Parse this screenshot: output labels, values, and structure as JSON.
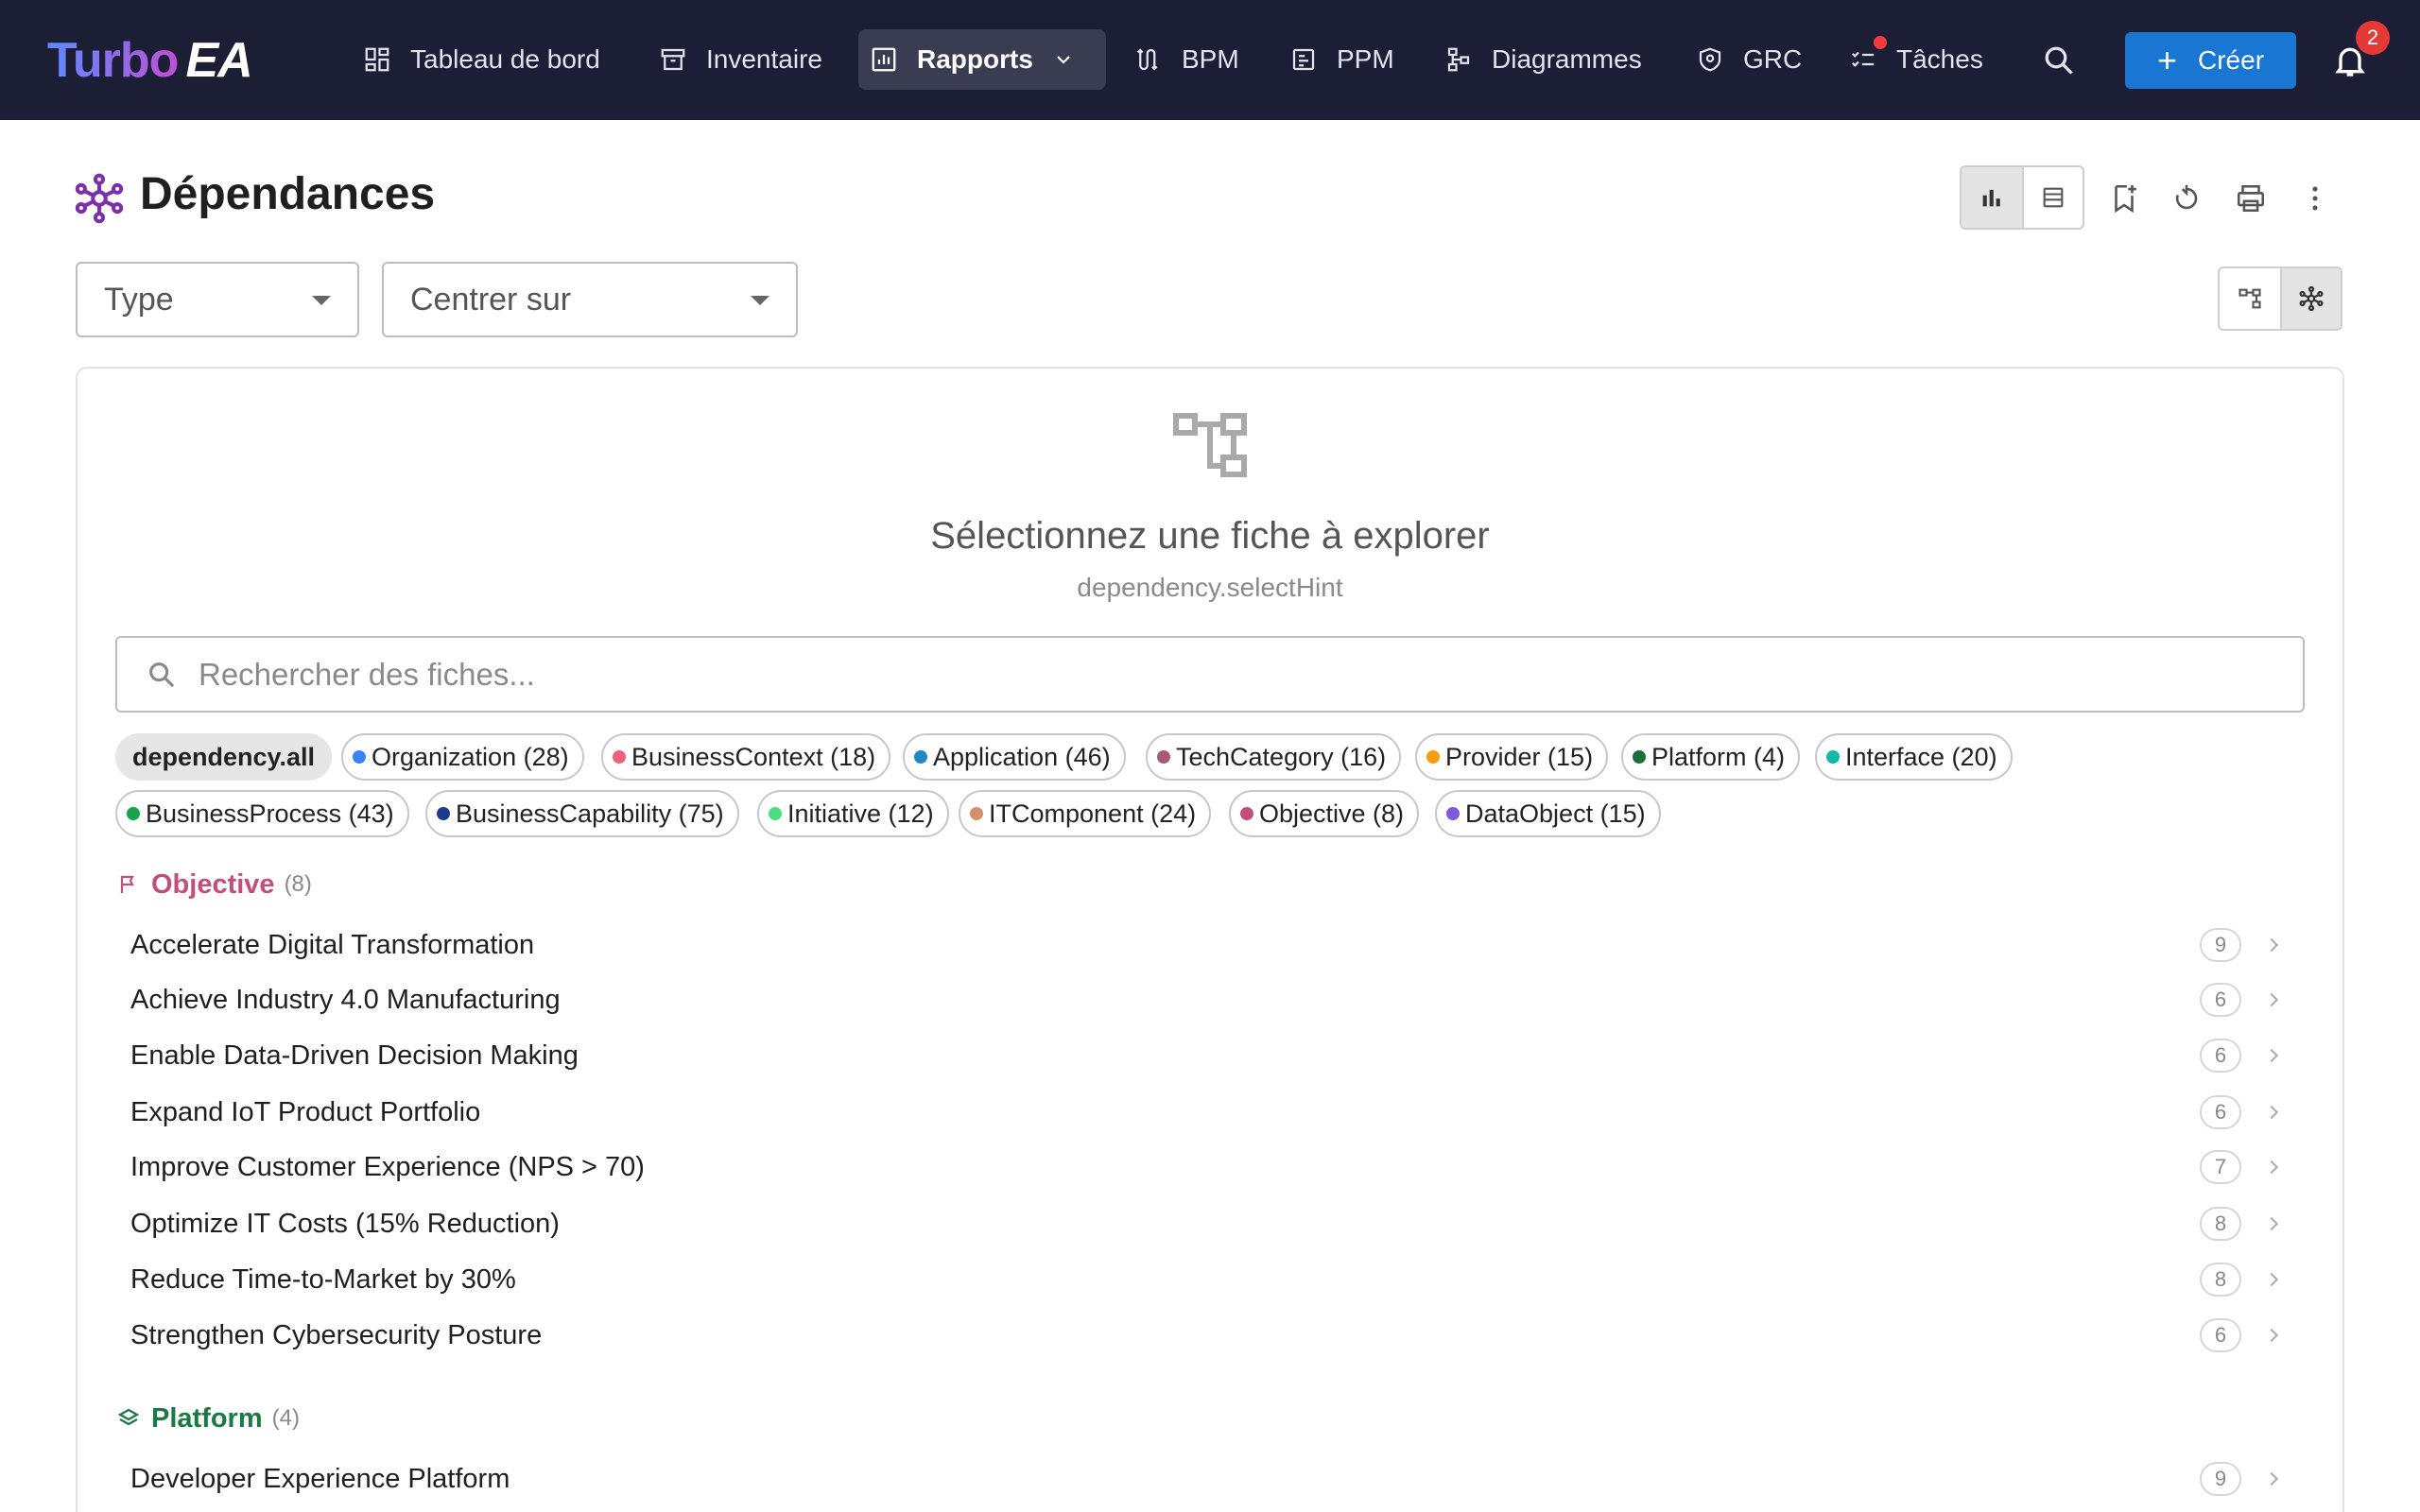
{
  "app": {
    "logo_turbo": "Turbo",
    "logo_ea": "EA"
  },
  "nav": {
    "items": [
      {
        "label": "Tableau de bord",
        "icon": "dashboard-icon"
      },
      {
        "label": "Inventaire",
        "icon": "archive-icon"
      },
      {
        "label": "Rapports",
        "icon": "report-icon",
        "active": true
      },
      {
        "label": "BPM",
        "icon": "process-icon"
      },
      {
        "label": "PPM",
        "icon": "project-icon"
      },
      {
        "label": "Diagrammes",
        "icon": "diagram-icon"
      },
      {
        "label": "GRC",
        "icon": "shield-icon"
      },
      {
        "label": "Tâches",
        "icon": "tasks-icon"
      }
    ],
    "create_label": "Créer",
    "notifications_count": "2"
  },
  "page": {
    "title": "Dépendances",
    "type_select": "Type",
    "center_select": "Centrer sur"
  },
  "empty": {
    "title": "Sélectionnez une fiche à explorer",
    "hint": "dependency.selectHint"
  },
  "search": {
    "placeholder": "Rechercher des fiches..."
  },
  "filters": {
    "all": "dependency.all",
    "chips": [
      {
        "label": "Organization (28)",
        "color": "#3b82f6"
      },
      {
        "label": "BusinessContext (18)",
        "color": "#f2607a"
      },
      {
        "label": "Application (46)",
        "color": "#1e88c8"
      },
      {
        "label": "TechCategory (16)",
        "color": "#a85a7a"
      },
      {
        "label": "Provider (15)",
        "color": "#f59e0b"
      },
      {
        "label": "Platform (4)",
        "color": "#1b6e3a"
      },
      {
        "label": "Interface (20)",
        "color": "#14b8a6"
      },
      {
        "label": "BusinessProcess (43)",
        "color": "#16a34a"
      },
      {
        "label": "BusinessCapability (75)",
        "color": "#1e3a8a"
      },
      {
        "label": "Initiative (12)",
        "color": "#4ade80"
      },
      {
        "label": "ITComponent (24)",
        "color": "#d4906a"
      },
      {
        "label": "Objective (8)",
        "color": "#c0507a"
      },
      {
        "label": "DataObject (15)",
        "color": "#7c5cd6"
      }
    ]
  },
  "groups": [
    {
      "name": "Objective",
      "count": "(8)",
      "color": "#c0507a",
      "icon": "flag-icon",
      "items": [
        {
          "name": "Accelerate Digital Transformation",
          "count": "9"
        },
        {
          "name": "Achieve Industry 4.0 Manufacturing",
          "count": "6"
        },
        {
          "name": "Enable Data-Driven Decision Making",
          "count": "6"
        },
        {
          "name": "Expand IoT Product Portfolio",
          "count": "6"
        },
        {
          "name": "Improve Customer Experience (NPS > 70)",
          "count": "7"
        },
        {
          "name": "Optimize IT Costs (15% Reduction)",
          "count": "8"
        },
        {
          "name": "Reduce Time-to-Market by 30%",
          "count": "8"
        },
        {
          "name": "Strengthen Cybersecurity Posture",
          "count": "6"
        }
      ]
    },
    {
      "name": "Platform",
      "count": "(4)",
      "color": "#1b7a44",
      "icon": "layers-icon",
      "items": [
        {
          "name": "Developer Experience Platform",
          "count": "9"
        }
      ]
    }
  ]
}
